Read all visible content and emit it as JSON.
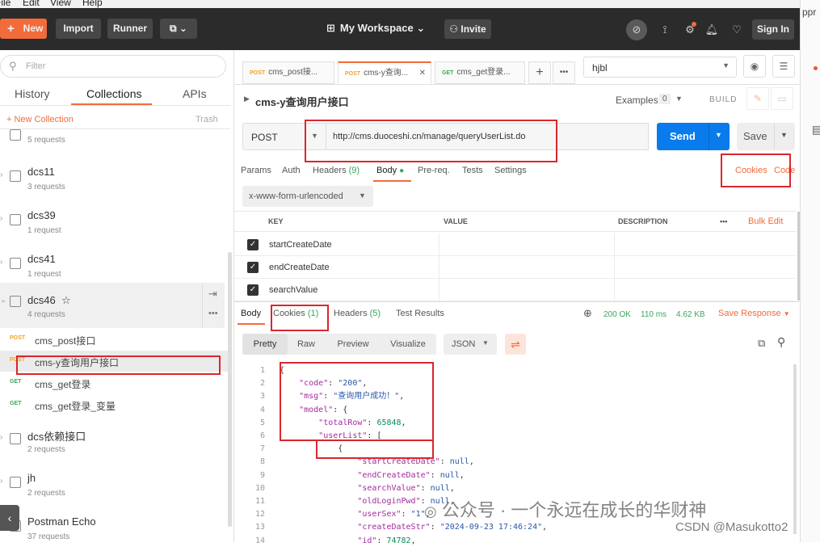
{
  "menu": [
    "File",
    "Edit",
    "View",
    "Help"
  ],
  "topbar": {
    "new_label": "New",
    "import_label": "Import",
    "runner_label": "Runner",
    "workspace_label": "My Workspace",
    "invite_label": "Invite",
    "signin_label": "Sign In"
  },
  "right_edge": {
    "text": "ppr"
  },
  "sidebar": {
    "filter_placeholder": "Filter",
    "tabs": [
      "History",
      "Collections",
      "APIs"
    ],
    "new_collection": "New Collection",
    "trash": "Trash",
    "collections": [
      {
        "name": "",
        "count": "5 requests"
      },
      {
        "name": "dcs11",
        "count": "3 requests"
      },
      {
        "name": "dcs39",
        "count": "1 request"
      },
      {
        "name": "dcs41",
        "count": "1 request"
      },
      {
        "name": "dcs46",
        "count": "4 requests",
        "star": "☆"
      }
    ],
    "requests": [
      {
        "method": "POST",
        "name": "cms_post接口"
      },
      {
        "method": "POST",
        "name": "cms-y查询用户接口"
      },
      {
        "method": "GET",
        "name": "cms_get登录"
      },
      {
        "method": "GET",
        "name": "cms_get登录_变量"
      }
    ],
    "collections2": [
      {
        "name": "dcs依赖接口",
        "count": "2 requests"
      },
      {
        "name": "jh",
        "count": "2 requests"
      },
      {
        "name": "Postman Echo",
        "count": "37 requests"
      }
    ]
  },
  "main": {
    "tabs": [
      {
        "method": "POST",
        "name": "cms_post接..."
      },
      {
        "method": "POST",
        "name": "cms-y查询..."
      },
      {
        "method": "GET",
        "name": "cms_get登录..."
      }
    ],
    "environment": "hjbl",
    "request_title": "cms-y查询用户接口",
    "examples_label": "Examples",
    "examples_count": "0",
    "build_label": "BUILD",
    "method": "POST",
    "url": "http://cms.duoceshi.cn/manage/queryUserList.do",
    "send_label": "Send",
    "save_label": "Save",
    "req_tabs": {
      "params": "Params",
      "auth": "Auth",
      "headers": "Headers",
      "headers_count": "(9)",
      "body": "Body",
      "prereq": "Pre-req.",
      "tests": "Tests",
      "settings": "Settings",
      "cookies": "Cookies",
      "code": "Code"
    },
    "body_type": "x-www-form-urlencoded",
    "kv_headers": {
      "key": "KEY",
      "value": "VALUE",
      "description": "DESCRIPTION",
      "bulk": "Bulk Edit"
    },
    "kv_rows": [
      "startCreateDate",
      "endCreateDate",
      "searchValue"
    ],
    "response": {
      "tabs": {
        "body": "Body",
        "cookies": "Cookies",
        "cookies_count": "(1)",
        "headers": "Headers",
        "headers_count": "(5)",
        "tests": "Test Results"
      },
      "status": "200 OK",
      "time": "110 ms",
      "size": "4.62 KB",
      "save": "Save Response",
      "views": [
        "Pretty",
        "Raw",
        "Preview",
        "Visualize"
      ],
      "format": "JSON"
    },
    "code_lines": [
      {
        "n": "1",
        "indent": "",
        "parts": [
          {
            "t": "{",
            "c": ""
          }
        ]
      },
      {
        "n": "2",
        "indent": "    ",
        "parts": [
          {
            "t": "\"code\"",
            "c": "key"
          },
          {
            "t": ": ",
            "c": ""
          },
          {
            "t": "\"200\"",
            "c": "str"
          },
          {
            "t": ",",
            "c": ""
          }
        ]
      },
      {
        "n": "3",
        "indent": "    ",
        "parts": [
          {
            "t": "\"msg\"",
            "c": "key"
          },
          {
            "t": ": ",
            "c": ""
          },
          {
            "t": "\"查询用户成功！\"",
            "c": "str"
          },
          {
            "t": ",",
            "c": ""
          }
        ]
      },
      {
        "n": "4",
        "indent": "    ",
        "parts": [
          {
            "t": "\"model\"",
            "c": "key"
          },
          {
            "t": ": {",
            "c": ""
          }
        ]
      },
      {
        "n": "5",
        "indent": "        ",
        "parts": [
          {
            "t": "\"totalRow\"",
            "c": "key"
          },
          {
            "t": ": ",
            "c": ""
          },
          {
            "t": "65848",
            "c": "num"
          },
          {
            "t": ",",
            "c": ""
          }
        ]
      },
      {
        "n": "6",
        "indent": "        ",
        "parts": [
          {
            "t": "\"userList\"",
            "c": "key"
          },
          {
            "t": ": [",
            "c": ""
          }
        ]
      },
      {
        "n": "7",
        "indent": "            ",
        "parts": [
          {
            "t": "{",
            "c": ""
          }
        ]
      },
      {
        "n": "8",
        "indent": "                ",
        "parts": [
          {
            "t": "\"startCreateDate\"",
            "c": "key"
          },
          {
            "t": ": ",
            "c": ""
          },
          {
            "t": "null",
            "c": "kw"
          },
          {
            "t": ",",
            "c": ""
          }
        ]
      },
      {
        "n": "9",
        "indent": "                ",
        "parts": [
          {
            "t": "\"endCreateDate\"",
            "c": "key"
          },
          {
            "t": ": ",
            "c": ""
          },
          {
            "t": "null",
            "c": "kw"
          },
          {
            "t": ",",
            "c": ""
          }
        ]
      },
      {
        "n": "10",
        "indent": "                ",
        "parts": [
          {
            "t": "\"searchValue\"",
            "c": "key"
          },
          {
            "t": ": ",
            "c": ""
          },
          {
            "t": "null",
            "c": "kw"
          },
          {
            "t": ",",
            "c": ""
          }
        ]
      },
      {
        "n": "11",
        "indent": "                ",
        "parts": [
          {
            "t": "\"oldLoginPwd\"",
            "c": "key"
          },
          {
            "t": ": ",
            "c": ""
          },
          {
            "t": "null",
            "c": "kw"
          },
          {
            "t": ",",
            "c": ""
          }
        ]
      },
      {
        "n": "12",
        "indent": "                ",
        "parts": [
          {
            "t": "\"userSex\"",
            "c": "key"
          },
          {
            "t": ": ",
            "c": ""
          },
          {
            "t": "\"1\"",
            "c": "str"
          },
          {
            "t": ",",
            "c": ""
          }
        ]
      },
      {
        "n": "13",
        "indent": "                ",
        "parts": [
          {
            "t": "\"createDateStr\"",
            "c": "key"
          },
          {
            "t": ": ",
            "c": ""
          },
          {
            "t": "\"2024-09-23 17:46:24\"",
            "c": "str"
          },
          {
            "t": ",",
            "c": ""
          }
        ]
      },
      {
        "n": "14",
        "indent": "                ",
        "parts": [
          {
            "t": "\"id\"",
            "c": "key"
          },
          {
            "t": ": ",
            "c": ""
          },
          {
            "t": "74782",
            "c": "num"
          },
          {
            "t": ",",
            "c": ""
          }
        ]
      }
    ]
  },
  "watermark": {
    "line1": "公众号 · 一个永远在成长的华财神",
    "line2": "CSDN @Masukotto2"
  },
  "colors": {
    "accent": "#f26b3a",
    "send": "#097bed",
    "annotation": "#d9272e",
    "post": "#f0a22a",
    "get": "#37a85b"
  }
}
